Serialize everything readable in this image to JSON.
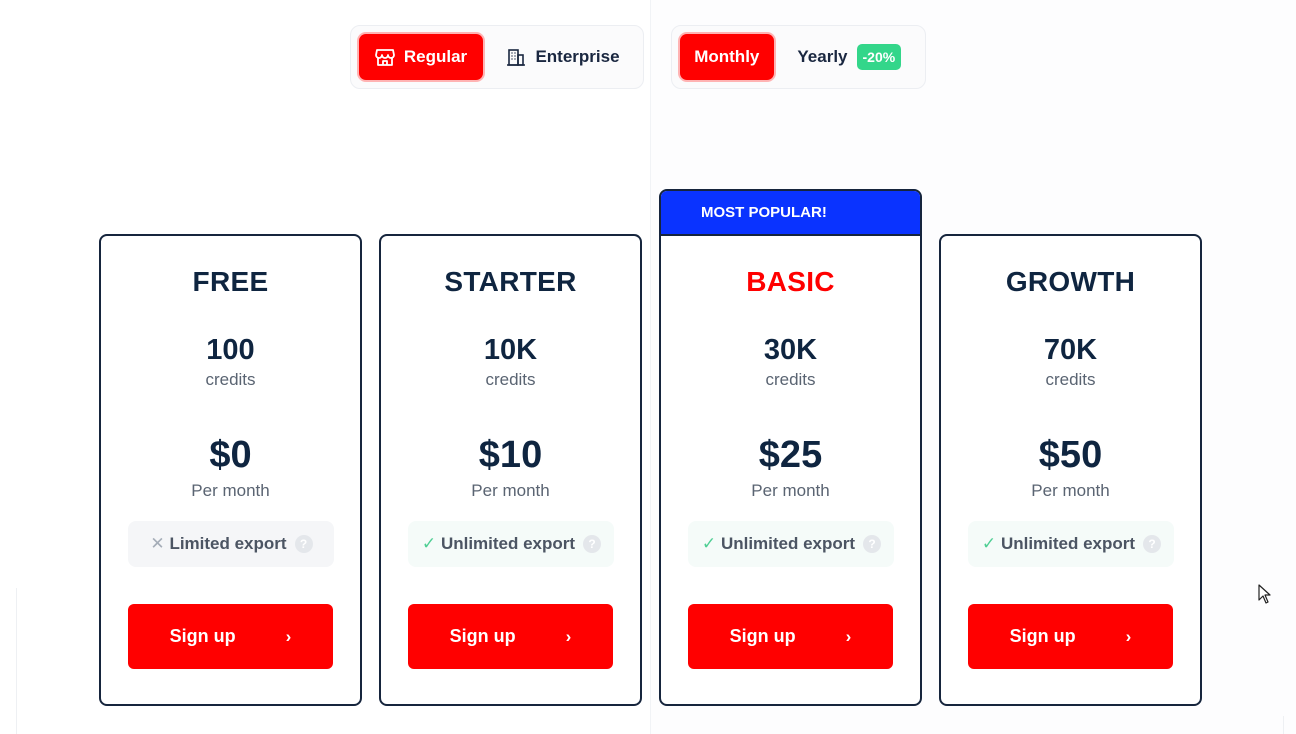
{
  "plan_toggle": {
    "options": [
      {
        "label": "Regular",
        "icon": "store-icon",
        "active": true
      },
      {
        "label": "Enterprise",
        "icon": "building-icon",
        "active": false
      }
    ]
  },
  "period_toggle": {
    "monthly_label": "Monthly",
    "yearly_label": "Yearly",
    "yearly_badge": "-20%",
    "active": "Monthly"
  },
  "popular_banner": "MOST POPULAR!",
  "plans": [
    {
      "name": "FREE",
      "credits": "100",
      "credits_label": "credits",
      "price": "$0",
      "period": "Per month",
      "feature": "Limited export",
      "feature_mark": "✕",
      "cta": "Sign up"
    },
    {
      "name": "STARTER",
      "credits": "10K",
      "credits_label": "credits",
      "price": "$10",
      "period": "Per month",
      "feature": "Unlimited export",
      "feature_mark": "✓",
      "cta": "Sign up"
    },
    {
      "name": "BASIC",
      "credits": "30K",
      "credits_label": "credits",
      "price": "$25",
      "period": "Per month",
      "feature": "Unlimited export",
      "feature_mark": "✓",
      "cta": "Sign up"
    },
    {
      "name": "GROWTH",
      "credits": "70K",
      "credits_label": "credits",
      "price": "$50",
      "period": "Per month",
      "feature": "Unlimited export",
      "feature_mark": "✓",
      "cta": "Sign up"
    }
  ],
  "colors": {
    "accent": "#ff0000",
    "popular_banner": "#0a33ff",
    "text_dark": "#0f2540",
    "badge_green": "#33d68a",
    "check_green": "#4fcf94"
  }
}
